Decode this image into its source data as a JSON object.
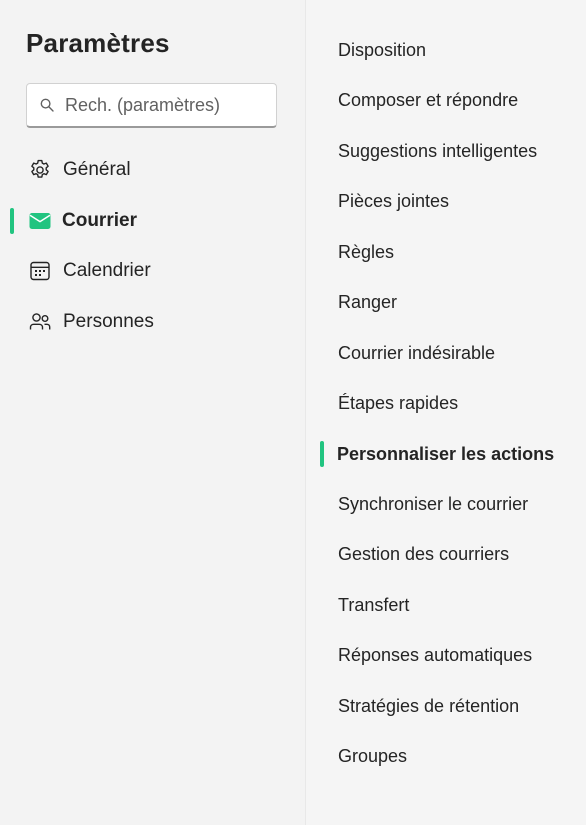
{
  "title": "Paramètres",
  "search": {
    "placeholder": "Rech. (paramètres)"
  },
  "accent_color": "#21c480",
  "nav": {
    "items": [
      {
        "label": "Général",
        "icon": "gear-icon",
        "selected": false
      },
      {
        "label": "Courrier",
        "icon": "mail-icon",
        "selected": true
      },
      {
        "label": "Calendrier",
        "icon": "calendar-icon",
        "selected": false
      },
      {
        "label": "Personnes",
        "icon": "people-icon",
        "selected": false
      }
    ]
  },
  "subnav": {
    "items": [
      {
        "label": "Disposition",
        "selected": false
      },
      {
        "label": "Composer et répondre",
        "selected": false
      },
      {
        "label": "Suggestions intelligentes",
        "selected": false
      },
      {
        "label": "Pièces jointes",
        "selected": false
      },
      {
        "label": "Règles",
        "selected": false
      },
      {
        "label": "Ranger",
        "selected": false
      },
      {
        "label": "Courrier indésirable",
        "selected": false
      },
      {
        "label": "Étapes rapides",
        "selected": false
      },
      {
        "label": "Personnaliser les actions",
        "selected": true
      },
      {
        "label": "Synchroniser le courrier",
        "selected": false
      },
      {
        "label": "Gestion des courriers",
        "selected": false
      },
      {
        "label": "Transfert",
        "selected": false
      },
      {
        "label": "Réponses automatiques",
        "selected": false
      },
      {
        "label": "Stratégies de rétention",
        "selected": false
      },
      {
        "label": "Groupes",
        "selected": false
      }
    ]
  }
}
